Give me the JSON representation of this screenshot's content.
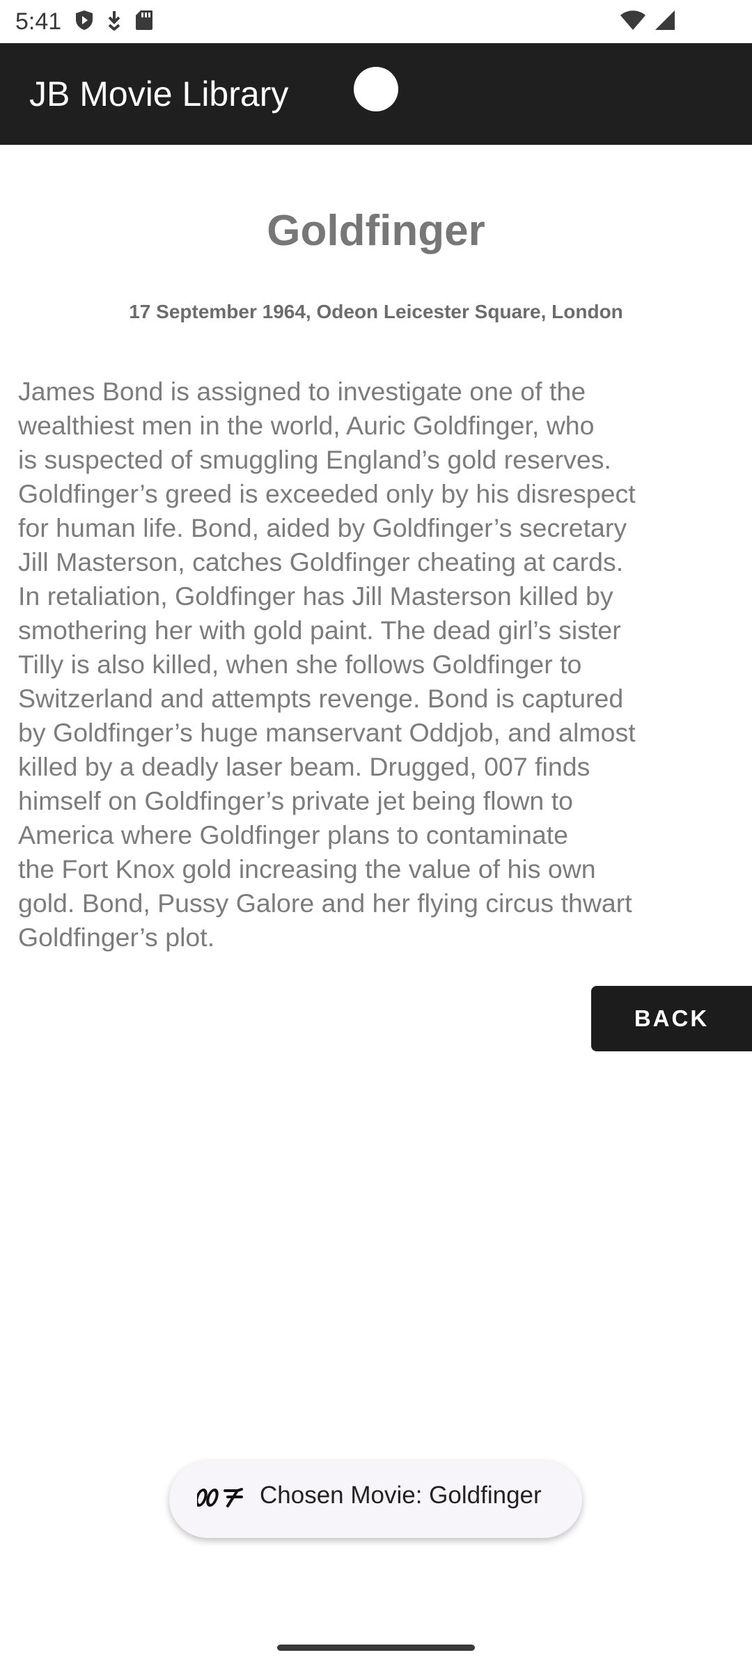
{
  "status_bar": {
    "time": "5:41",
    "left_icons": [
      "shield-play-icon",
      "download-arrow-icon",
      "sd-card-icon"
    ],
    "right_icons": [
      "wifi-icon",
      "cellular-signal-icon"
    ]
  },
  "app_bar": {
    "title": "JB Movie Library"
  },
  "movie": {
    "title": "Goldfinger",
    "premiere": "17 September 1964, Odeon Leicester Square, London",
    "synopsis_lines": [
      "James Bond is assigned to investigate one of the",
      "wealthiest men in the world, Auric Goldfinger, who",
      "is suspected of smuggling England’s gold reserves.",
      "Goldfinger’s greed is exceeded only by his disrespect",
      "for human life. Bond, aided by Goldfinger’s secretary",
      "Jill Masterson, catches Goldfinger cheating at cards.",
      "In retaliation, Goldfinger has Jill Masterson killed by",
      "smothering her with gold paint. The dead girl’s sister",
      "Tilly is also killed, when she follows Goldfinger to",
      "Switzerland and attempts revenge. Bond is captured",
      "by Goldfinger’s huge manservant Oddjob, and almost",
      "killed by a deadly laser beam. Drugged, 007 finds",
      "himself on Goldfinger’s private jet being flown to",
      "America where Goldfinger plans to contaminate",
      "the Fort Knox gold increasing the value of his own",
      "gold. Bond, Pussy Galore and her flying circus thwart",
      "Goldfinger’s plot."
    ]
  },
  "actions": {
    "back_label": "BACK"
  },
  "toast": {
    "logo": "007",
    "message": "Chosen Movie: Goldfinger"
  },
  "colors": {
    "app_bar_bg": "#1f1f1f",
    "button_bg": "#1c1c1c",
    "title_text": "#777777",
    "body_text": "#7c7c7c"
  }
}
